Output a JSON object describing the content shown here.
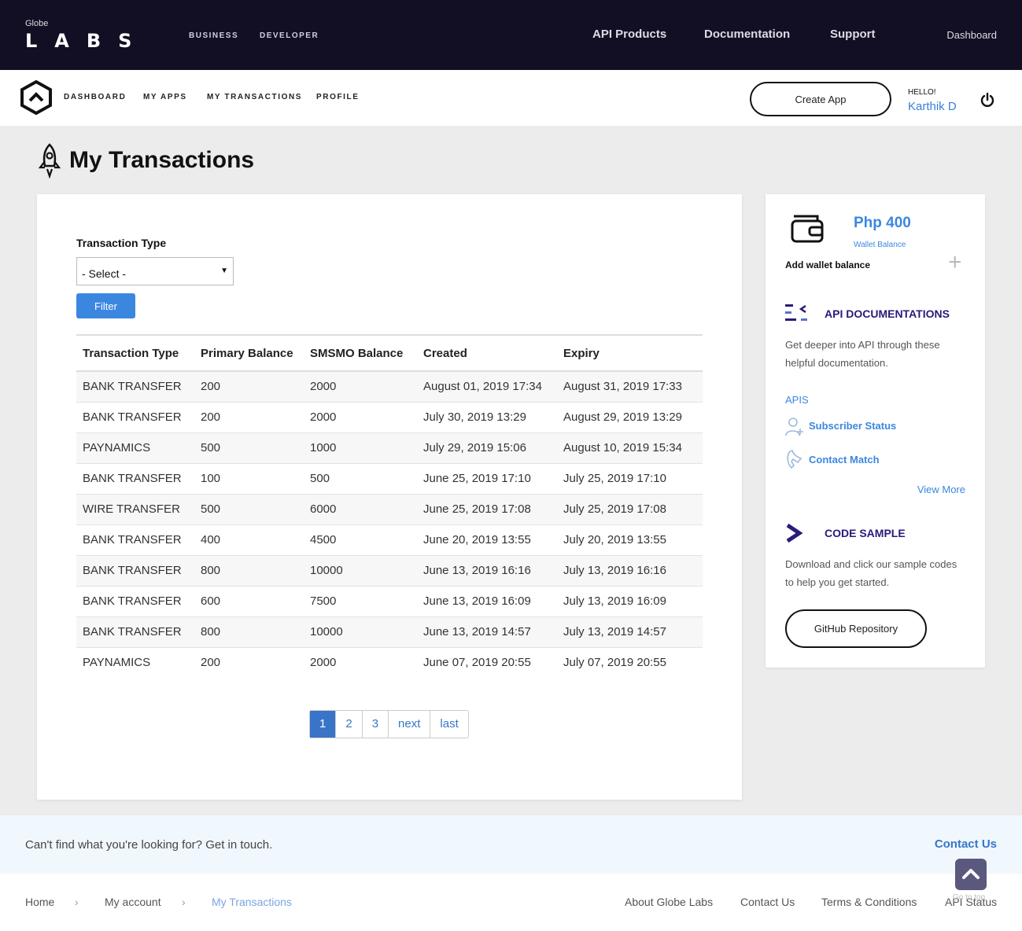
{
  "topbar": {
    "logo_small": "Globe",
    "logo_big": "LABS",
    "segments": [
      "BUSINESS",
      "DEVELOPER"
    ],
    "links": [
      "API Products",
      "Documentation",
      "Support"
    ],
    "dashboard": "Dashboard"
  },
  "subnav": {
    "links": [
      "DASHBOARD",
      "MY APPS",
      "MY TRANSACTIONS",
      "PROFILE"
    ],
    "create_app": "Create App",
    "hello": "HELLO!",
    "user_name": "Karthik D"
  },
  "page": {
    "title": "My Transactions"
  },
  "filter": {
    "label": "Transaction Type",
    "selected": "- Select -",
    "button": "Filter"
  },
  "table": {
    "headers": [
      "Transaction Type",
      "Primary Balance",
      "SMSMO Balance",
      "Created",
      "Expiry"
    ],
    "rows": [
      [
        "BANK TRANSFER",
        "200",
        "2000",
        "August 01, 2019 17:34",
        "August 31, 2019 17:33"
      ],
      [
        "BANK TRANSFER",
        "200",
        "2000",
        "July 30, 2019 13:29",
        "August 29, 2019 13:29"
      ],
      [
        "PAYNAMICS",
        "500",
        "1000",
        "July 29, 2019 15:06",
        "August 10, 2019 15:34"
      ],
      [
        "BANK TRANSFER",
        "100",
        "500",
        "June 25, 2019 17:10",
        "July 25, 2019 17:10"
      ],
      [
        "WIRE TRANSFER",
        "500",
        "6000",
        "June 25, 2019 17:08",
        "July 25, 2019 17:08"
      ],
      [
        "BANK TRANSFER",
        "400",
        "4500",
        "June 20, 2019 13:55",
        "July 20, 2019 13:55"
      ],
      [
        "BANK TRANSFER",
        "800",
        "10000",
        "June 13, 2019 16:16",
        "July 13, 2019 16:16"
      ],
      [
        "BANK TRANSFER",
        "600",
        "7500",
        "June 13, 2019 16:09",
        "July 13, 2019 16:09"
      ],
      [
        "BANK TRANSFER",
        "800",
        "10000",
        "June 13, 2019 14:57",
        "July 13, 2019 14:57"
      ],
      [
        "PAYNAMICS",
        "200",
        "2000",
        "June 07, 2019 20:55",
        "July 07, 2019 20:55"
      ]
    ]
  },
  "pagination": {
    "pages": [
      "1",
      "2",
      "3"
    ],
    "next": "next",
    "last": "last",
    "active": "1"
  },
  "sidebar": {
    "wallet_amount": "Php 400",
    "wallet_label": "Wallet Balance",
    "add_wallet": "Add wallet balance",
    "api_docs_title": "API DOCUMENTATIONS",
    "api_docs_text": "Get deeper into API through these helpful documentation.",
    "apis_label": "APIS",
    "api_links": [
      "Subscriber Status",
      "Contact Match"
    ],
    "view_more": "View More",
    "code_title": "CODE SAMPLE",
    "code_text": "Download and click our sample codes to help you get started.",
    "github": "GitHub Repository"
  },
  "footer": {
    "question": "Can't find what you're looking for? Get in touch.",
    "contact_us": "Contact Us",
    "breadcrumb": [
      "Home",
      "My account",
      "My Transactions"
    ],
    "links": [
      "About Globe Labs",
      "Contact Us",
      "Terms & Conditions",
      "API Status"
    ],
    "back_to_top": "Go to top"
  },
  "colors": {
    "accent": "#3b87e0",
    "topbar_bg": "#120f24",
    "heading_purple": "#2a1a7a"
  }
}
